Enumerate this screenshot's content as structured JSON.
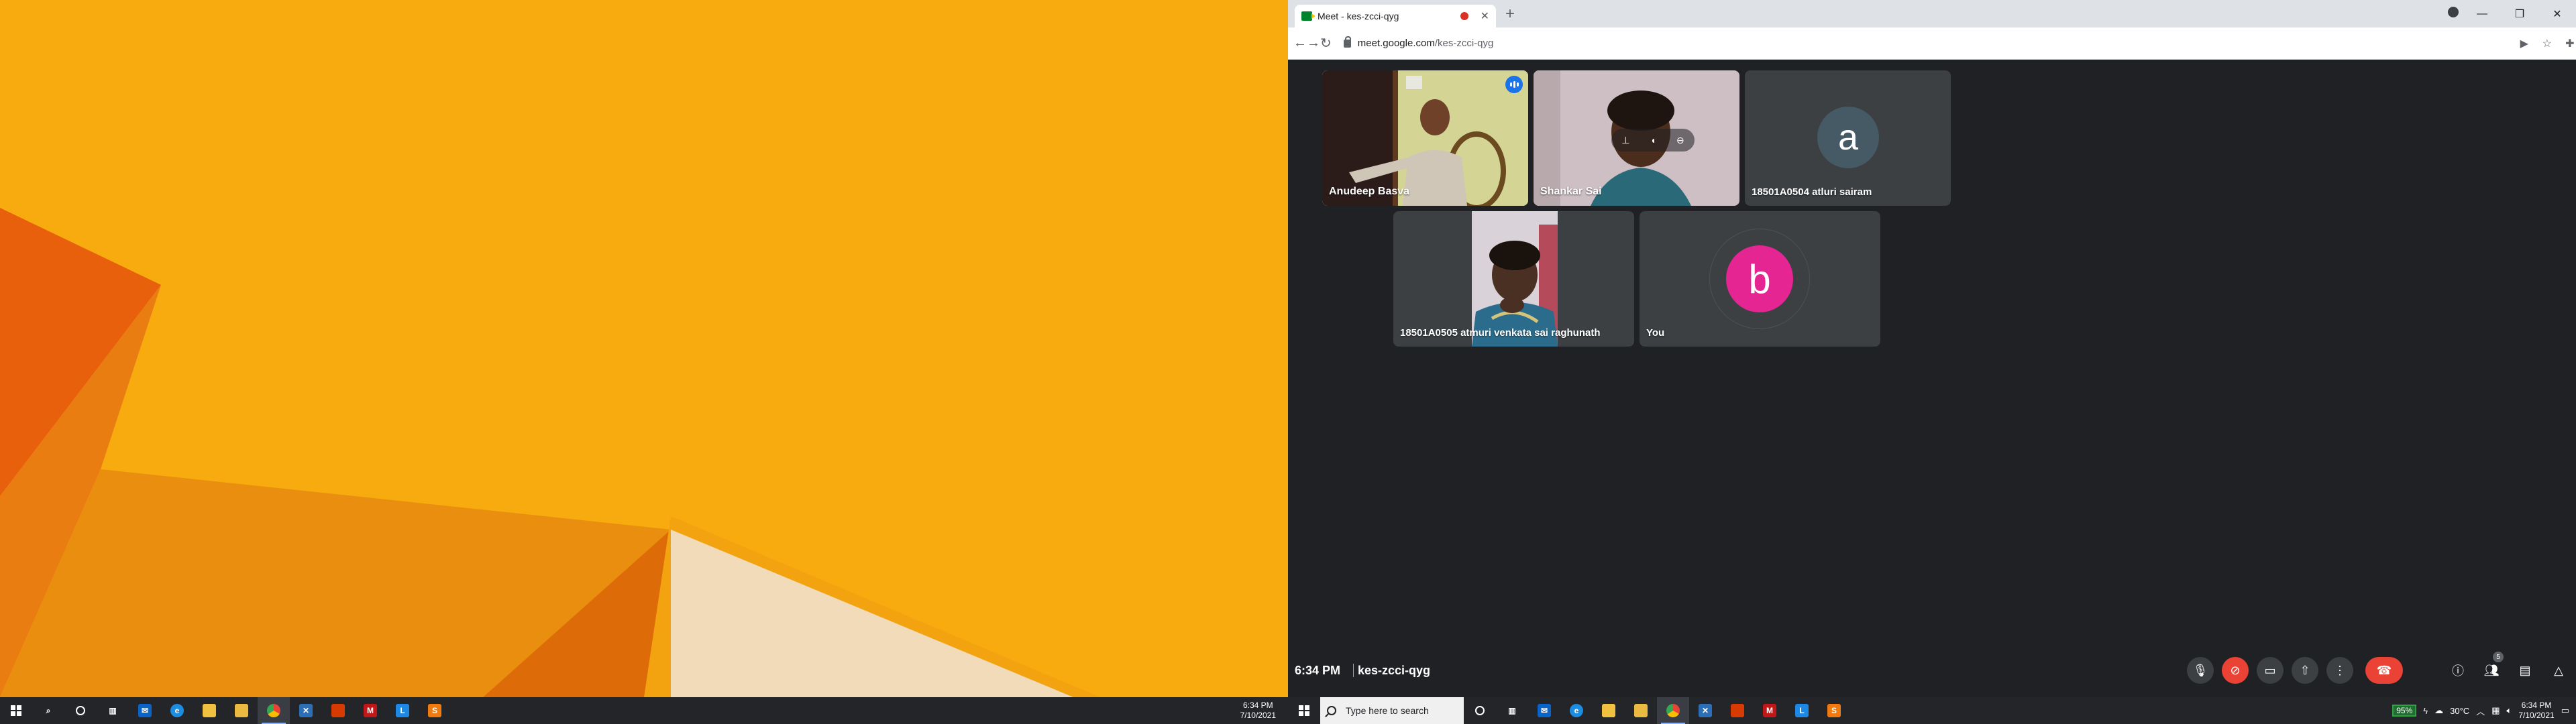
{
  "left_taskbar": {
    "time": "6:34 PM",
    "date": "7/10/2021"
  },
  "browser": {
    "tab_title": "Meet - kes-zcci-qyg",
    "url_host": "meet.google.com",
    "url_path": "/kes-zcci-qyg",
    "profile_initial": "b"
  },
  "meet": {
    "participants": [
      {
        "name": "Anudeep Basva",
        "type": "video",
        "speaking": true
      },
      {
        "name": "Shankar Sai",
        "type": "video",
        "speaking": false
      },
      {
        "name": "18501A0504 atluri sairam",
        "type": "avatar",
        "initial": "a",
        "avatar_color": "#455a64"
      },
      {
        "name": "18501A0505 atmuri venkata sai raghunath",
        "type": "video"
      },
      {
        "name": "You",
        "type": "avatar",
        "initial": "b",
        "avatar_color": "#e52592"
      }
    ],
    "meeting_time": "6:34 PM",
    "meeting_code": "kes-zcci-qyg",
    "people_count": "5"
  },
  "right_taskbar": {
    "search_placeholder": "Type here to search",
    "battery": "95%",
    "temperature": "30°C",
    "time": "6:34 PM",
    "date": "7/10/2021"
  },
  "colors": {
    "accent": "#1a73e8",
    "end_call": "#ea4335",
    "wallpaper": "#f7ab0e"
  }
}
